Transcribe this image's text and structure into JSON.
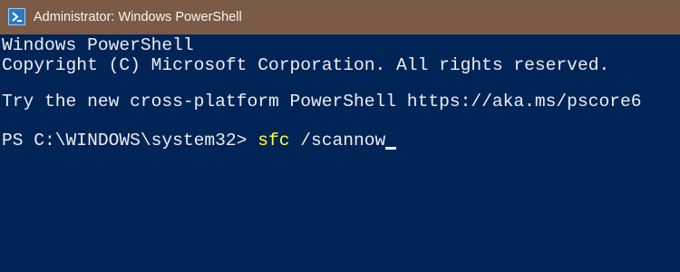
{
  "window": {
    "title": "Administrator: Windows PowerShell",
    "icon": "powershell-icon"
  },
  "console": {
    "banner_name": "Windows PowerShell",
    "copyright": "Copyright (C) Microsoft Corporation. All rights reserved.",
    "promo": "Try the new cross-platform PowerShell https://aka.ms/pscore6",
    "prompt": "PS C:\\WINDOWS\\system32> ",
    "command": "sfc",
    "argument": " /scannow"
  },
  "colors": {
    "titlebar": "#7b5a46",
    "background": "#012456",
    "text": "#eeedf0",
    "command": "#ffff3a"
  }
}
